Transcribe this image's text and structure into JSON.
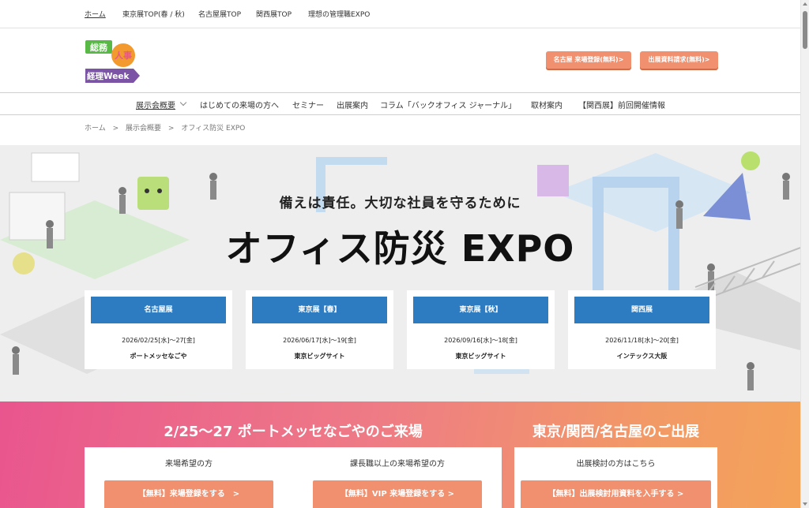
{
  "topnav": {
    "items": [
      "ホーム",
      "東京展TOP(春 / 秋)",
      "名古屋展TOP",
      "関西展TOP",
      "理想の管理職EXPO"
    ]
  },
  "logo": {
    "line1": "総務",
    "badge": "人事",
    "line2": "経理Week",
    "colors": {
      "green": "#58b947",
      "orange": "#f39a2e",
      "purple": "#7b54a6"
    }
  },
  "header": {
    "nagoya_register_label": "名古屋 来場登録(無料)>",
    "exhibit_docs_label": "出展資料請求(無料)>"
  },
  "mainnav": {
    "items": [
      "展示会概要",
      "はじめての来場の方へ",
      "セミナー",
      "出展案内",
      "コラム「バックオフィス ジャーナル」",
      "取材案内",
      "【関西展】前回開催情報"
    ]
  },
  "breadcrumb": [
    "ホーム",
    ">",
    "展示会概要",
    ">",
    "オフィス防災 EXPO"
  ],
  "hero": {
    "tagline": "備えは責任。大切な社員を守るために",
    "title": "オフィス防災 EXPO",
    "cards": [
      {
        "label": "名古屋展",
        "date": "2026/02/25[水]～27[金]",
        "venue": "ポートメッセなごや"
      },
      {
        "label": "東京展【春】",
        "date": "2026/06/17[水]～19[金]",
        "venue": "東京ビッグサイト"
      },
      {
        "label": "東京展【秋】",
        "date": "2026/09/16[水]～18[金]",
        "venue": "東京ビッグサイト"
      },
      {
        "label": "関西展",
        "date": "2026/11/18[水]～20[金]",
        "venue": "インテックス大阪"
      }
    ]
  },
  "register": {
    "visit_heading": "2/25～27 ポートメッセなごやのご来場",
    "exhibit_heading": "東京/関西/名古屋のご出展",
    "visitor_label": "来場希望の方",
    "visitor_button": "【無料】来場登録をする　>",
    "manager_label": "課長職以上の来場希望の方",
    "manager_button": "【無料】VIP 来場登録をする >",
    "exhibitor_label": "出展検討の方はこちら",
    "exhibitor_button": "【無料】出展検討用資料を入手する >"
  },
  "colors": {
    "accent_orange": "#f0906e",
    "card_blue": "#2d7cc1",
    "gradient_start": "#e9558e",
    "gradient_end": "#f4a259"
  }
}
